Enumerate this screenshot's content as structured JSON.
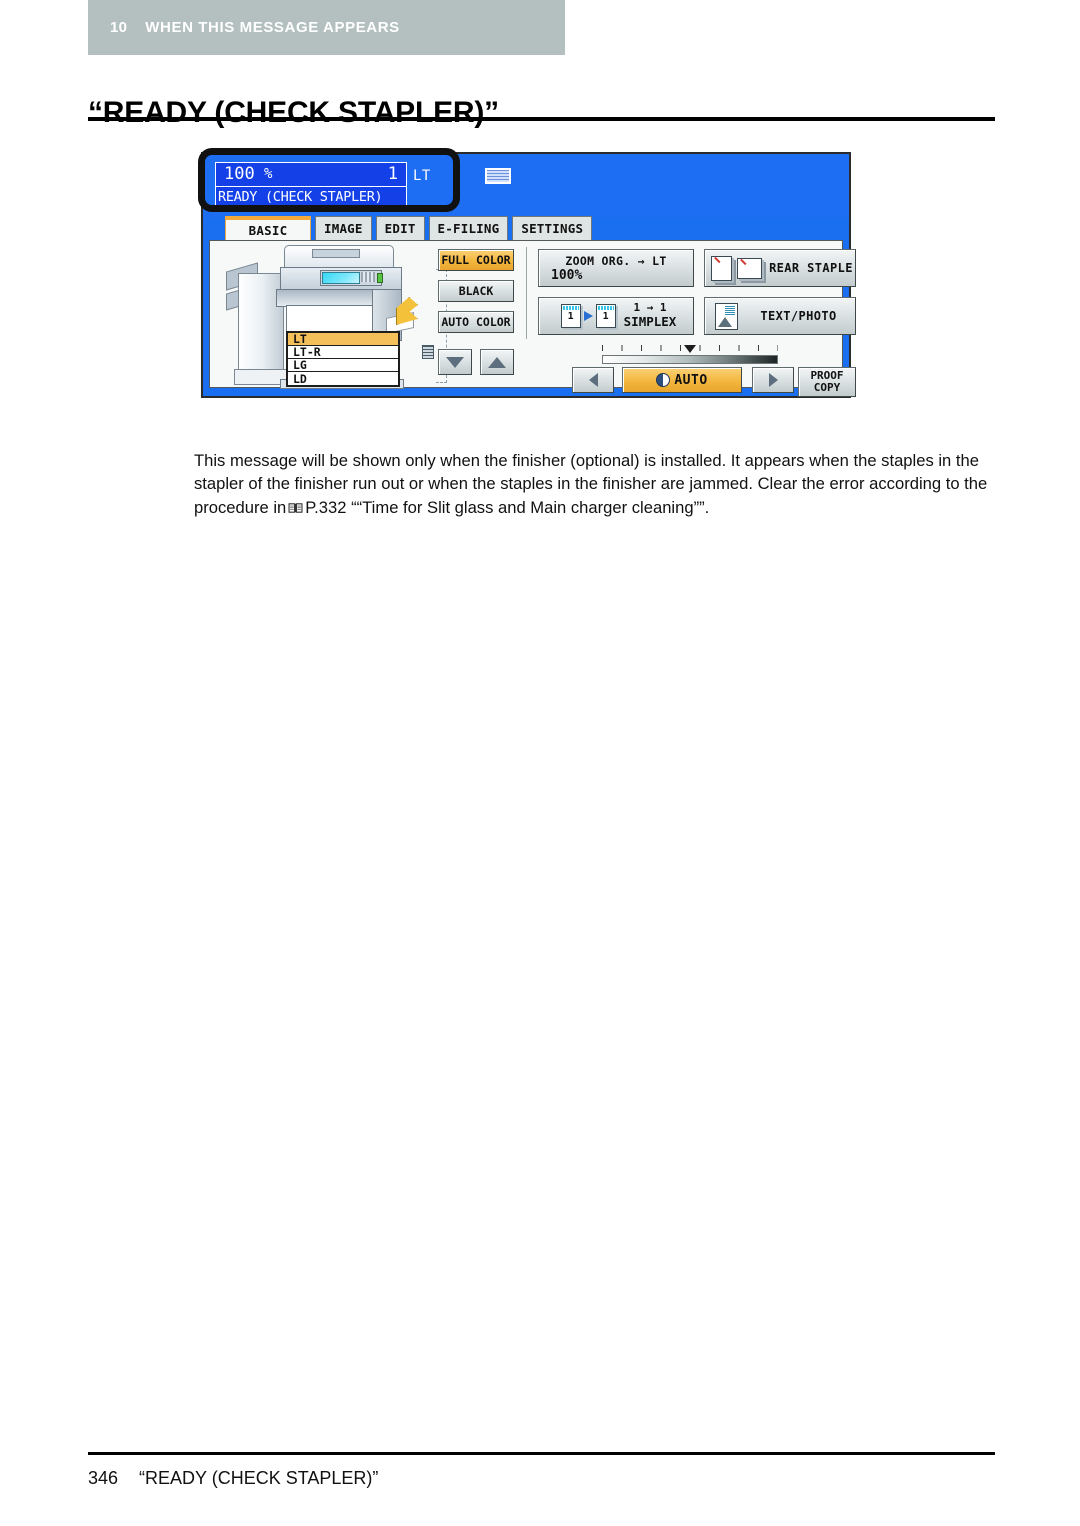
{
  "running_head": {
    "chapter_number": "10",
    "chapter_title": "WHEN THIS MESSAGE APPEARS"
  },
  "page_title": "“READY (CHECK STAPLER)”",
  "figure": {
    "status": {
      "zoom_value": "100",
      "zoom_unit": "%",
      "copy_count": "1",
      "paper_size": "LT",
      "message": "READY (CHECK STAPLER)"
    },
    "tabs": [
      {
        "label": "BASIC",
        "active": true
      },
      {
        "label": "IMAGE",
        "active": false
      },
      {
        "label": "EDIT",
        "active": false
      },
      {
        "label": "E-FILING",
        "active": false
      },
      {
        "label": "SETTINGS",
        "active": false
      }
    ],
    "paper_trays": [
      {
        "label": "LT",
        "selected": true
      },
      {
        "label": "LT-R",
        "selected": false
      },
      {
        "label": "LG",
        "selected": false
      },
      {
        "label": "LD",
        "selected": false
      }
    ],
    "color_modes": [
      {
        "label": "FULL COLOR",
        "selected": true
      },
      {
        "label": "BLACK",
        "selected": false
      },
      {
        "label": "AUTO COLOR",
        "selected": false
      }
    ],
    "zoom_button": {
      "line1": "ZOOM  ORG. → LT",
      "line2": "100%"
    },
    "duplex_button": {
      "icon_left_number": "1",
      "icon_right_number": "1",
      "line1": "1 → 1",
      "line2": "SIMPLEX"
    },
    "staple_button": {
      "label": "REAR STAPLE"
    },
    "original_mode_button": {
      "label": "TEXT/PHOTO"
    },
    "density": {
      "auto_label": "AUTO",
      "left_arrow": "◁",
      "right_arrow": "▷"
    },
    "proof_copy_button": {
      "line1": "PROOF",
      "line2": "COPY"
    },
    "colors": {
      "panel_blue": "#1d6ef2",
      "status_blue": "#1440e8",
      "accent_amber": "#f3b63f",
      "tab_active_accent": "#f2a93b",
      "panel_body": "#f7f9f9"
    }
  },
  "body": {
    "part1": "This message will be shown only when the finisher (optional) is installed. It appears when the staples in the stapler of the finisher run out or when the staples in the finisher are jammed. Clear the error according to the procedure in",
    "reference": "P.332",
    "part2": "““Time for Slit glass and Main charger cleaning””."
  },
  "footer": {
    "page_number": "346",
    "title": "“READY (CHECK STAPLER)”"
  }
}
